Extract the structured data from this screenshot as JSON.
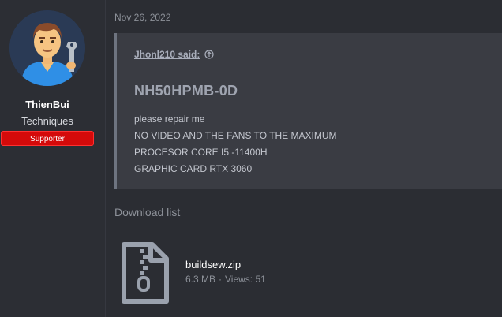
{
  "user": {
    "name": "ThienBui",
    "title": "Techniques",
    "badge": "Supporter",
    "avatar_icon": "mechanic-avatar-icon"
  },
  "post": {
    "date": "Nov 26, 2022",
    "quote": {
      "author": "Jhonl210 said:",
      "heading": "NH50HPMB-0D",
      "lines": [
        "please repair me",
        "NO VIDEO AND THE FANS TO THE MAXIMUM",
        "PROCESOR CORE I5 -11400H",
        "GRAPHIC CARD RTX 3060"
      ]
    }
  },
  "download": {
    "heading": "Download list",
    "file": {
      "name": "buildsew.zip",
      "size": "6.3 MB",
      "separator": "·",
      "views": "Views: 51",
      "icon": "zip-file-icon"
    }
  },
  "colors": {
    "background": "#2b2d33",
    "quote_bg": "#3a3c43",
    "badge": "#d40a0a"
  }
}
